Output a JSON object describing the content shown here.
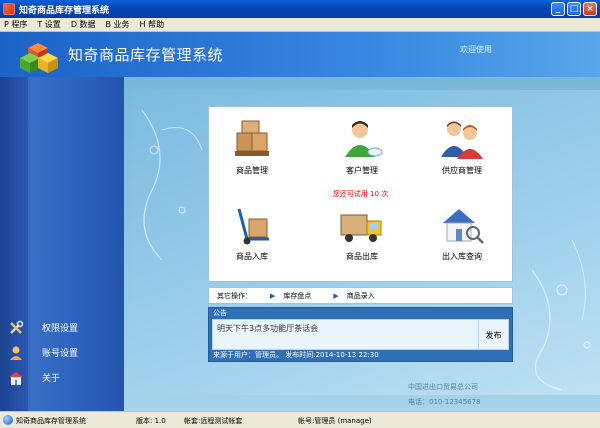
{
  "window": {
    "title": "知奇商品库存管理系统",
    "min_glyph": "_",
    "max_glyph": "□",
    "close_glyph": "×"
  },
  "menu": [
    "P 程序",
    "T 设置",
    "D 数据",
    "B 业务",
    "H 帮助"
  ],
  "banner": {
    "app_title": "知奇商品库存管理系统",
    "welcome": "欢迎使用"
  },
  "sidebar": {
    "items": [
      {
        "label": "权限设置",
        "icon": "tools-icon"
      },
      {
        "label": "账号设置",
        "icon": "user-icon"
      },
      {
        "label": "关于",
        "icon": "building-icon"
      }
    ]
  },
  "tiles": [
    {
      "label": "商品管理",
      "icon": "boxes-pallet-icon"
    },
    {
      "label": "客户管理",
      "icon": "customer-icon"
    },
    {
      "label": "供应商管理",
      "icon": "supplier-icon"
    },
    {
      "label": "商品入库",
      "icon": "handtruck-icon"
    },
    {
      "label": "商品出库",
      "icon": "truck-icon"
    },
    {
      "label": "出入库查询",
      "icon": "house-search-icon"
    }
  ],
  "trial_notice": "您还可试用 10 次",
  "other_ops": {
    "label": "其它操作：",
    "links": [
      "库存盘点",
      "商品录入"
    ]
  },
  "notice": {
    "title": "公告",
    "content": "明天下午3点多功能厅茶话会",
    "publish_label": "发布",
    "footer": "来源于用户：管理员。 发布时间:2014-10-13 22:30"
  },
  "footer_info": {
    "company": "中国进出口贸易总公司",
    "phone": "电话：010-12345678"
  },
  "statusbar": {
    "app_name": "知奇商品库存管理系统",
    "version": "版本: 1.0",
    "account": "帐套:远程测试帐套",
    "user": "帐号:管理员 (manage)"
  },
  "colors": {
    "titlebar": "#0846b8",
    "banner": "#2e7ad9",
    "sidebar": "#2e63bf",
    "main_bg": "#8ec6e2",
    "notice_bg": "#2f6fb6",
    "trial_red": "#e00000"
  }
}
